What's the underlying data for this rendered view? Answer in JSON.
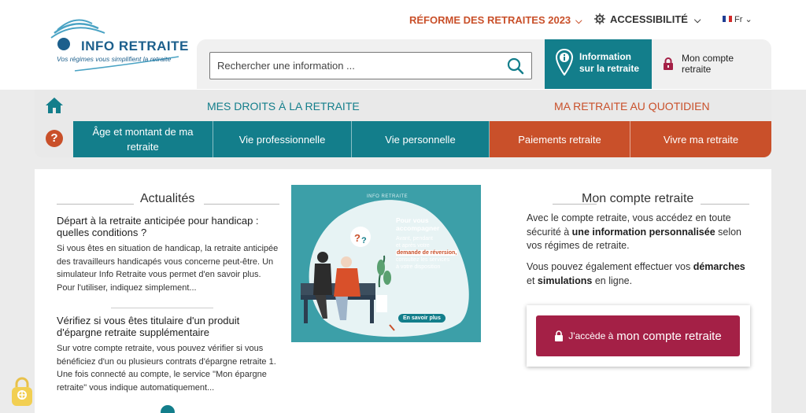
{
  "header": {
    "logo": {
      "name": "INFO RETRAITE",
      "tagline": "Vos régimes vous simplifient la retraite"
    },
    "reform_link": "RÉFORME DES RETRAITES 2023",
    "accessibility": "ACCESSIBILITÉ",
    "language": "Fr",
    "search": {
      "placeholder": "Rechercher une information ..."
    },
    "info_button": {
      "line1": "Information",
      "line2": "sur la retraite"
    },
    "account_link": {
      "line1": "Mon compte",
      "line2": "retraite"
    }
  },
  "nav": {
    "section_left": "MES DROITS À LA RETRAITE",
    "section_right": "MA RETRAITE AU QUOTIDIEN",
    "tabs": [
      {
        "label": "Âge et montant de ma retraite"
      },
      {
        "label": "Vie professionnelle"
      },
      {
        "label": "Vie personnelle"
      },
      {
        "label": "Paiements retraite"
      },
      {
        "label": "Vivre ma retraite"
      }
    ]
  },
  "news": {
    "heading": "Actualités",
    "articles": [
      {
        "title": "Départ à la retraite anticipée pour handicap : quelles conditions ?",
        "body": "Si vous êtes en situation de handicap, la retraite anticipée des travailleurs handicapés vous concerne peut-être. Un simulateur Info Retraite vous permet d'en savoir plus. Pour l'utiliser, indiquez simplement..."
      },
      {
        "title": "Vérifiez si vous êtes titulaire d'un produit d'épargne retraite supplémentaire",
        "body": "Sur votre compte retraite, vous pouvez vérifier si vous bénéficiez d'un ou plusieurs contrats d'épargne retraite 1.  Une fois connecté au compte, le service \"Mon épargne retraite\" vous indique automatiquement..."
      }
    ]
  },
  "promo": {
    "label": "INFO RETRAITE",
    "title_line1": "Pour vous",
    "title_line2": "accompagner",
    "body_line1": "Avant, pendant",
    "body_line2": "et après votre",
    "highlight": "demande de réversion,",
    "body_line3": "consultez les services",
    "body_line4": "à votre disposition",
    "button": "En savoir plus"
  },
  "account": {
    "heading": "Mon compte retraite",
    "p1_a": "Avec le compte retraite, vous accédez en toute sécurité à ",
    "p1_b": "une information personnalisée",
    "p1_c": " selon vos régimes de retraite.",
    "p2_a": "Vous pouvez également effectuer vos ",
    "p2_b": "démarches",
    "p2_c": " et ",
    "p2_d": "simulations",
    "p2_e": " en ligne.",
    "cta_small": "J'accède à",
    "cta_big": "mon compte retraite"
  },
  "colors": {
    "teal": "#137e8b",
    "orange": "#c9502a",
    "crimson": "#a42046"
  }
}
